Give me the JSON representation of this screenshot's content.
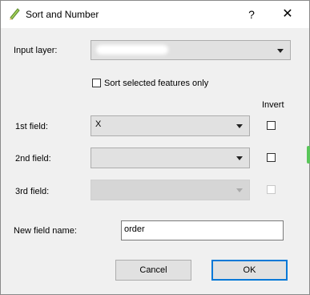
{
  "window": {
    "title": "Sort and Number"
  },
  "titlebar": {
    "help_label": "?",
    "close_label": "✕"
  },
  "form": {
    "input_layer_label": "Input layer:",
    "sort_selected_label": "Sort selected features only",
    "invert_header": "Invert",
    "first_field_label": "1st field:",
    "first_field_value": "X",
    "second_field_label": "2nd field:",
    "second_field_value": "",
    "third_field_label": "3rd field:",
    "third_field_value": "",
    "new_field_label": "New field name:",
    "new_field_value": "order"
  },
  "buttons": {
    "cancel_label": "Cancel",
    "ok_label": "OK"
  },
  "icons": {
    "app": "qgis-pencil-icon",
    "dropdown": "chevron-down-icon"
  }
}
